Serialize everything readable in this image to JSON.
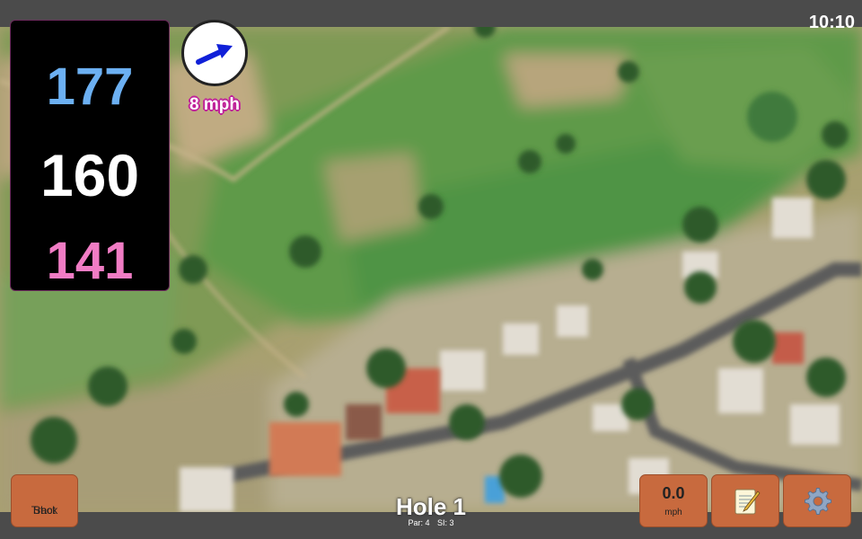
{
  "status_bar": {
    "time": "10:10"
  },
  "distances": {
    "back": "177",
    "middle": "160",
    "front": "141"
  },
  "wind": {
    "speed": "8 mph",
    "direction_icon": "arrow-icon"
  },
  "hole": {
    "title": "Hole 1",
    "par": "Par: 4",
    "si": "SI: 3"
  },
  "buttons": {
    "track_shot_line1": "Track",
    "track_shot_line2": "Shot",
    "speed_value": "0.0",
    "speed_unit": "mph",
    "notes_icon": "notepad-icon",
    "settings_icon": "gear-icon"
  },
  "colors": {
    "back_distance": "#6cb0f2",
    "middle_distance": "#ffffff",
    "front_distance": "#f07cc4",
    "button_bg": "#c86a3e",
    "wind_arrow": "#1020d8"
  }
}
